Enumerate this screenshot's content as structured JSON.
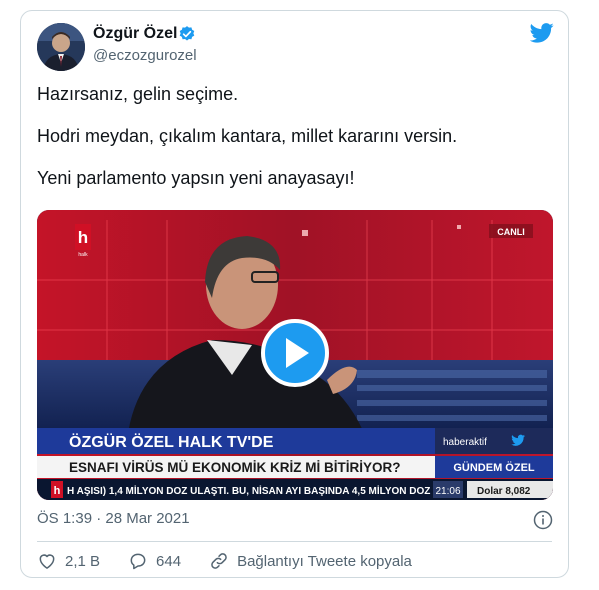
{
  "tweet": {
    "author_name": "Özgür Özel",
    "handle": "@eczozgurozel",
    "lines": [
      "Hazırsanız, gelin seçime.",
      "Hodri meydan, çıkalım kantara, millet kararını versin.",
      "Yeni parlamento yapsın yeni anayasayı!"
    ],
    "timestamp": "ÖS 1:39 · 28 Mar 2021"
  },
  "video": {
    "channel_logo_letter": "h",
    "channel_logo_sub": "halk",
    "live_badge": "CANLI",
    "lower_third_title": "ÖZGÜR ÖZEL HALK TV'DE",
    "source_tag": "haberaktif",
    "headline": "ESNAFI VİRÜS MÜ EKONOMİK KRİZ Mİ BİTİRİYOR?",
    "program_name": "GÜNDEM ÖZEL",
    "ticker_text": "H AŞISI) 1,4 MİLYON DOZ ULAŞTI. BU, NİSAN AYI BAŞINDA 4,5 MİLYON DOZ",
    "clock": "21:06",
    "dollar_rate": "Dolar 8,082"
  },
  "actions": {
    "like_count": "2,1 B",
    "reply_count": "644",
    "copy_link_label": "Bağlantıyı Tweete kopyala"
  },
  "colors": {
    "twitter_blue": "#1d9bf0",
    "secondary_text": "#536471",
    "border": "#cfd9de"
  }
}
